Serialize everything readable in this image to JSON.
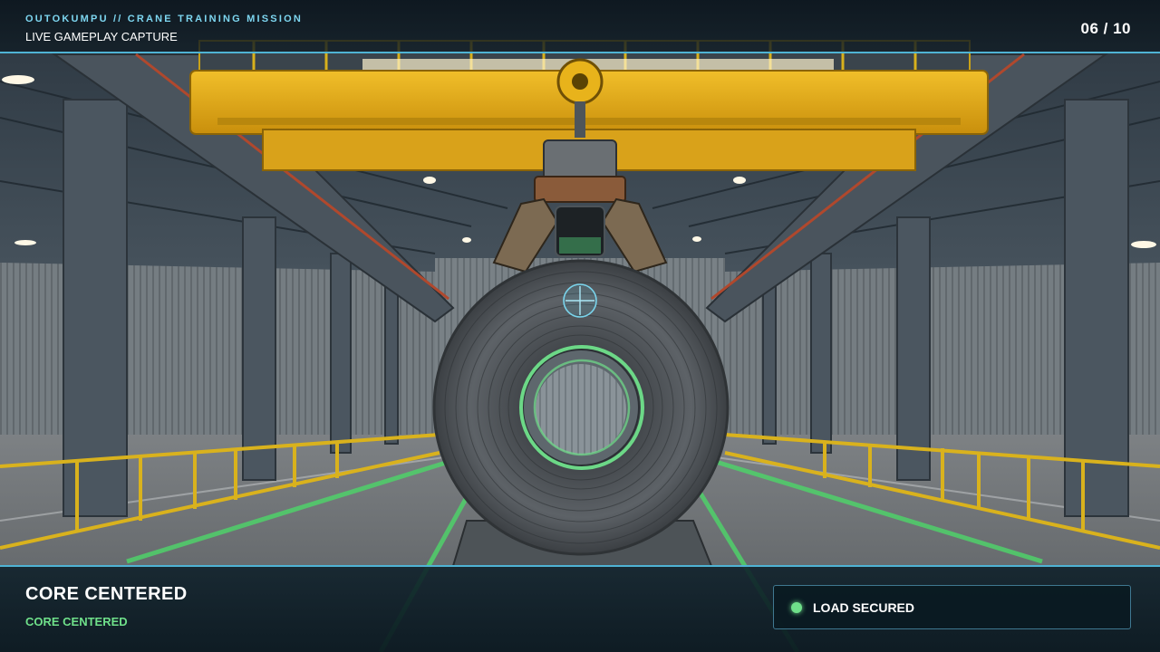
{
  "header": {
    "mission_title": "OUTOKUMPU // CRANE TRAINING MISSION",
    "capture_label": "LIVE GAMEPLAY CAPTURE",
    "progress": "06 / 10"
  },
  "status": {
    "heading": "CORE CENTERED",
    "subtext": "CORE CENTERED",
    "load_indicator": "LOAD SECURED"
  },
  "colors": {
    "hud_accent": "#4fb3d4",
    "success_green": "#6fe08a",
    "crane_yellow": "#e2a816",
    "reticle": "#7ad4ec"
  },
  "scene": {
    "environment": "steel-warehouse",
    "crane_icon": "overhead-crane",
    "load_icon": "steel-coil",
    "reticle_icon": "crosshair-icon",
    "core_ring_icon": "alignment-ring-icon"
  }
}
